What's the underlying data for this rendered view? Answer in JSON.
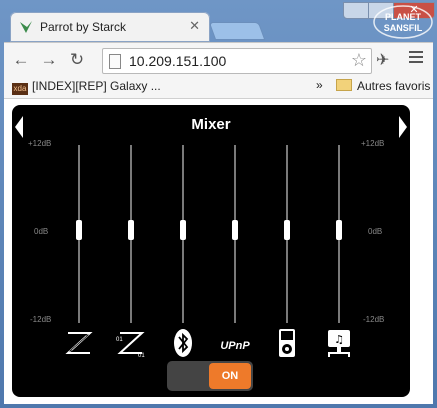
{
  "browser": {
    "tab_title": "Parrot by Starck",
    "address": "10.209.151.100",
    "bookmark_1": "[INDEX][REP] Galaxy ...",
    "bookmark_1_favicon": "xda",
    "bookmarks_overflow": "»",
    "bookmark_folder": "Autres favoris",
    "brand_watermark": "PLANET SANSFIL"
  },
  "mixer": {
    "title": "Mixer",
    "db_labels": {
      "top": "+12dB",
      "mid": "0dB",
      "bottom": "-12dB"
    },
    "channels": [
      {
        "icon": "line-in-icon",
        "level_db": 0
      },
      {
        "icon": "digital-line-in-icon",
        "level_db": 0
      },
      {
        "icon": "bluetooth-icon",
        "level_db": 0
      },
      {
        "icon": "upnp-icon",
        "label": "UPnP",
        "level_db": 0
      },
      {
        "icon": "ipod-icon",
        "level_db": 0
      },
      {
        "icon": "network-music-icon",
        "level_db": 0
      }
    ],
    "toggle_label": "ON",
    "colors": {
      "accent": "#ee7a2a",
      "panel": "#000000",
      "track": "#7a7a7a"
    }
  }
}
